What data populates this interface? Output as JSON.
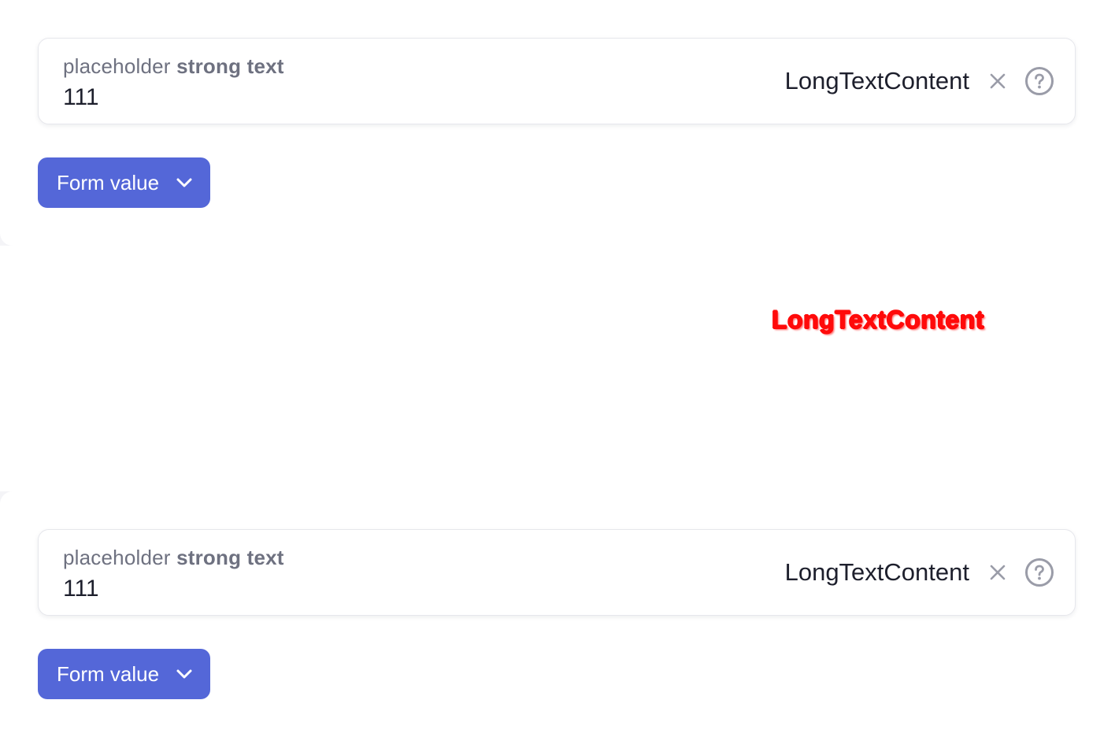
{
  "top": {
    "field": {
      "label_regular": "placeholder",
      "label_strong": "strong text",
      "value": "111",
      "suffix": "LongTextContent",
      "clear_icon": "close-icon",
      "help_icon": "question-circle-icon"
    },
    "button": {
      "label": "Form value",
      "icon": "chevron-down-icon"
    }
  },
  "diff": {
    "text": "LongTextContent",
    "color": "#ff0a0a"
  },
  "bottom": {
    "field": {
      "label_regular": "placeholder",
      "label_strong": "strong text",
      "value": "111",
      "suffix": "LongTextContent",
      "clear_icon": "close-icon",
      "help_icon": "question-circle-icon"
    },
    "button": {
      "label": "Form value",
      "icon": "chevron-down-icon"
    }
  },
  "colors": {
    "accent": "#5467d8",
    "text": "#1d1f2c",
    "muted": "#6e7180",
    "icon": "#9a9ca8",
    "border": "#e6e7ec"
  }
}
